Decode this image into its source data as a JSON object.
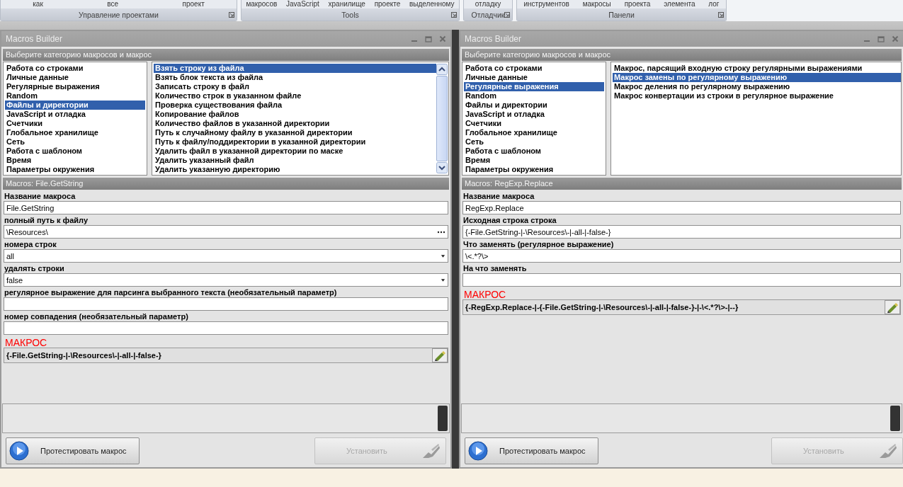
{
  "ribbon": {
    "groups": [
      {
        "title": "Управление проектами",
        "items": [
          "как",
          "все",
          "проект"
        ]
      },
      {
        "title": "Tools",
        "items": [
          "макросов",
          "JavaScript",
          "хранилище",
          "проекте",
          "выделенному"
        ]
      },
      {
        "title": "Отладчик",
        "items": [
          "отладку"
        ]
      },
      {
        "title": "Панели",
        "items": [
          "инструментов",
          "макросы",
          "проекта",
          "элемента",
          "лог"
        ]
      }
    ]
  },
  "windows": [
    {
      "title": "Macros Builder",
      "section_title": "Выберите категорию макросов и макрос",
      "categories": [
        {
          "label": "Работа со строками",
          "selected": false
        },
        {
          "label": "Личные данные",
          "selected": false
        },
        {
          "label": "Регулярные выражения",
          "selected": false
        },
        {
          "label": "Random",
          "selected": false
        },
        {
          "label": "Файлы и директории",
          "selected": true
        },
        {
          "label": "JavaScript и отладка",
          "selected": false
        },
        {
          "label": "Счетчики",
          "selected": false
        },
        {
          "label": "Глобальное хранилище",
          "selected": false
        },
        {
          "label": "Сеть",
          "selected": false
        },
        {
          "label": "Работа с шаблоном",
          "selected": false
        },
        {
          "label": "Время",
          "selected": false
        },
        {
          "label": "Параметры окружения",
          "selected": false
        }
      ],
      "macros": [
        {
          "label": "Взять строку из файла",
          "selected": true
        },
        {
          "label": "Взять блок текста из файла",
          "selected": false
        },
        {
          "label": "Записать строку в файл",
          "selected": false
        },
        {
          "label": "Количество строк в указанном файле",
          "selected": false
        },
        {
          "label": "Проверка существования файла",
          "selected": false
        },
        {
          "label": "Копирование файлов",
          "selected": false
        },
        {
          "label": "Количество файлов в указанной директории",
          "selected": false
        },
        {
          "label": "Путь к случайному файлу в указанной директории",
          "selected": false
        },
        {
          "label": "Путь к файлу/поддиректории в указанной директории",
          "selected": false
        },
        {
          "label": "Удалить файл в указанной директории по маске",
          "selected": false
        },
        {
          "label": "Удалить указанный файл",
          "selected": false
        },
        {
          "label": "Удалить указанную директорию",
          "selected": false
        }
      ],
      "macro_header": "Macros: File.GetString",
      "fields": [
        {
          "label": "Название макроса",
          "value": "File.GetString",
          "kind": "text"
        },
        {
          "label": "полный путь к файлу",
          "value": "\\Resources\\",
          "kind": "browse"
        },
        {
          "label": "номера строк",
          "value": "all",
          "kind": "select"
        },
        {
          "label": "удалять строки",
          "value": "false",
          "kind": "select"
        },
        {
          "label": "регулярное выражение для парсинга выбранного текста (необязательный параметр)",
          "kind": "text"
        },
        {
          "label": "номер совпадения (необязательный параметр)",
          "kind": "text"
        }
      ],
      "result_label": "МАКРОС",
      "result": "{-File.GetString-|-\\Resources\\-|-all-|-false-}",
      "test_button": "Протестировать макрос",
      "install_button": {
        "label": "Установить",
        "disabled": true
      }
    },
    {
      "title": "Macros Builder",
      "section_title": "Выберите категорию макросов и макрос",
      "categories": [
        {
          "label": "Работа со строками",
          "selected": false
        },
        {
          "label": "Личные данные",
          "selected": false
        },
        {
          "label": "Регулярные выражения",
          "selected": true
        },
        {
          "label": "Random",
          "selected": false
        },
        {
          "label": "Файлы и директории",
          "selected": false
        },
        {
          "label": "JavaScript и отладка",
          "selected": false
        },
        {
          "label": "Счетчики",
          "selected": false
        },
        {
          "label": "Глобальное хранилище",
          "selected": false
        },
        {
          "label": "Сеть",
          "selected": false
        },
        {
          "label": "Работа с шаблоном",
          "selected": false
        },
        {
          "label": "Время",
          "selected": false
        },
        {
          "label": "Параметры окружения",
          "selected": false
        }
      ],
      "macros": [
        {
          "label": "Макрос, парсящий входную строку регулярными выражениями",
          "selected": false
        },
        {
          "label": "Макрос замены по регулярному выражению",
          "selected": true
        },
        {
          "label": "Макрос деления по регулярному выражению",
          "selected": false
        },
        {
          "label": "Макрос конвертации из строки в регулярное выражение",
          "selected": false
        }
      ],
      "macro_header": "Macros: RegExp.Replace",
      "fields": [
        {
          "label": "Название макроса",
          "value": "RegExp.Replace",
          "kind": "text"
        },
        {
          "label": "Исходная строка строка",
          "value": "{-File.GetString-|-\\Resources\\-|-all-|-false-}",
          "kind": "text"
        },
        {
          "label": "Что заменять (регулярное выражение)",
          "value": "\\<.*?\\>",
          "kind": "text"
        },
        {
          "label": "На что заменять",
          "kind": "text"
        }
      ],
      "result_label": "МАКРОС",
      "result": "{-RegExp.Replace-|-{-File.GetString-|-\\Resources\\-|-all-|-false-}-|-\\<.*?\\>-|--}",
      "test_button": "Протестировать макрос",
      "install_button": {
        "label": "Установить",
        "disabled": true
      }
    }
  ]
}
